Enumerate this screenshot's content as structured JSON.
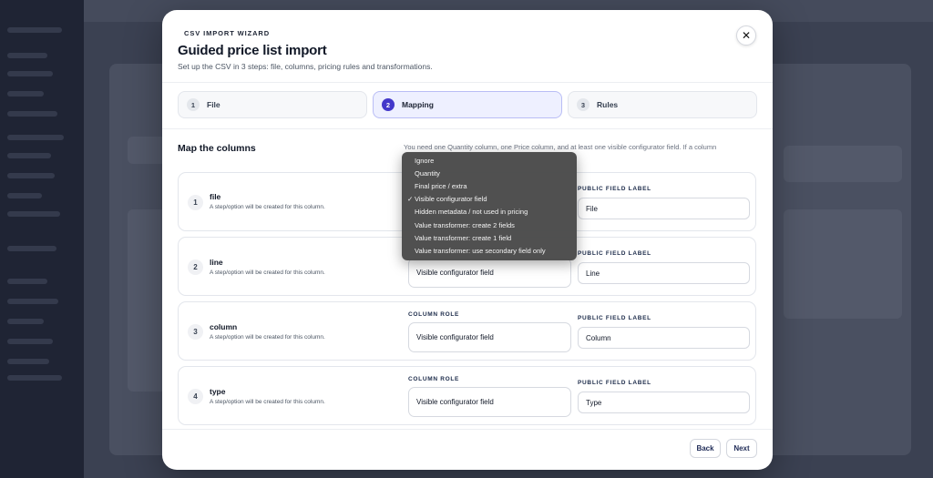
{
  "wizard": {
    "eyebrow": "CSV IMPORT WIZARD",
    "title": "Guided price list import",
    "subtitle": "Set up the CSV in 3 steps: file, columns, pricing rules and transformations.",
    "close_icon": "close-icon",
    "close_glyph": "✕"
  },
  "steps": [
    {
      "num": "1",
      "label": "File",
      "active": false
    },
    {
      "num": "2",
      "label": "Mapping",
      "active": true
    },
    {
      "num": "3",
      "label": "Rules",
      "active": false
    }
  ],
  "mapping": {
    "title": "Map the columns",
    "note": "You need one Quantity column, one Price column, and at least one visible configurator field. If a column",
    "role_label": "COLUMN ROLE",
    "public_label": "PUBLIC FIELD LABEL",
    "rows": [
      {
        "num": "1",
        "name": "file",
        "desc": "A step/option will be created for this column.",
        "role": "Visible configurator field",
        "public": "File"
      },
      {
        "num": "2",
        "name": "line",
        "desc": "A step/option will be created for this column.",
        "role": "Visible configurator field",
        "public": "Line"
      },
      {
        "num": "3",
        "name": "column",
        "desc": "A step/option will be created for this column.",
        "role": "Visible configurator field",
        "public": "Column"
      },
      {
        "num": "4",
        "name": "type",
        "desc": "A step/option will be created for this column.",
        "role": "Visible configurator field",
        "public": "Type"
      }
    ]
  },
  "dropdown": {
    "selected_mark": "✓",
    "options": [
      {
        "label": "Ignore",
        "selected": false
      },
      {
        "label": "Quantity",
        "selected": false
      },
      {
        "label": "Final price / extra",
        "selected": false
      },
      {
        "label": "Visible configurator field",
        "selected": true
      },
      {
        "label": "Hidden metadata / not used in pricing",
        "selected": false
      },
      {
        "label": "Value transformer: create 2 fields",
        "selected": false
      },
      {
        "label": "Value transformer: create 1 field",
        "selected": false
      },
      {
        "label": "Value transformer: use secondary field only",
        "selected": false
      }
    ]
  },
  "footer": {
    "back_label": "Back",
    "next_label": "Next"
  },
  "colors": {
    "accent": "#4338ca",
    "active_step_bg": "#eef0ff",
    "dropdown_bg": "#4a4a4a"
  }
}
